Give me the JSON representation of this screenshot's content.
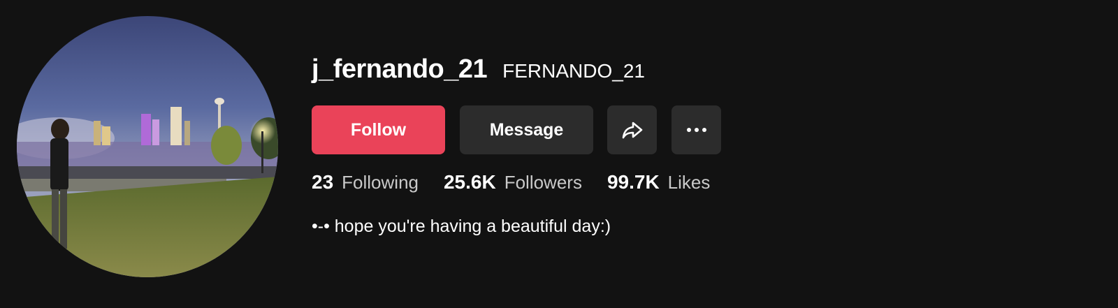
{
  "profile": {
    "username": "j_fernando_21",
    "nickname": "FERNANDO_21",
    "avatar_icon": "avatar-photo-night-waterfall-park"
  },
  "actions": {
    "follow_label": "Follow",
    "message_label": "Message",
    "share_icon": "share-icon",
    "more_icon": "more-icon"
  },
  "stats": [
    {
      "value": "23",
      "label": "Following"
    },
    {
      "value": "25.6K",
      "label": "Followers"
    },
    {
      "value": "99.7K",
      "label": "Likes"
    }
  ],
  "bio": "•-• hope you're having a beautiful day:)",
  "colors": {
    "background": "#121212",
    "follow_button": "#ea4359",
    "secondary_button": "#2c2c2c",
    "label_text": "#c9c9c9"
  }
}
